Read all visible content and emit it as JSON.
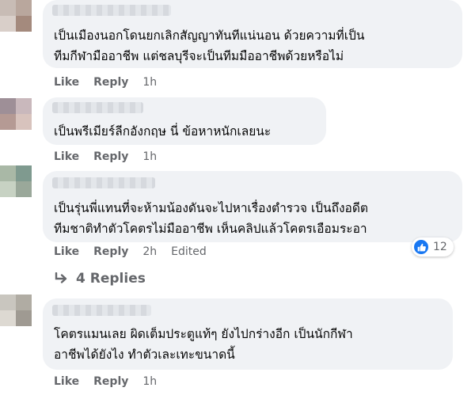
{
  "comments": [
    {
      "lines": [
        "เป็นเมืองนอกโดนยกเลิกสัญญาทันทีแน่นอน ด้วยความที่เป็น",
        "ทีมกีฬามืออาชีพ แต่ชลบุรีจะเป็นทีมมืออาชีพด้วยหรือไม่"
      ],
      "like": "Like",
      "reply": "Reply",
      "time": "1h",
      "avatar_colors": [
        "#c8bcb5",
        "#b9a79d",
        "#d9cfc9",
        "#a48a7d"
      ]
    },
    {
      "lines": [
        "เป็นพรีเมียร์ลีกอังกฤษ นี่ ข้อหาหนักเลยนะ"
      ],
      "like": "Like",
      "reply": "Reply",
      "time": "1h",
      "avatar_colors": [
        "#9e8f97",
        "#c9b8bc",
        "#b59a94",
        "#d8c3bd"
      ]
    },
    {
      "lines": [
        "เป็นรุ่นพี่แทนที่จะห้ามน้องดันจะไปหาเรื่องตำรวจ เป็นถึงอดีต",
        "ทีมชาติทำตัวโคตรไม่มืออาชีพ เห็นคลิปแล้วโคตรเอือมระอา"
      ],
      "like": "Like",
      "reply": "Reply",
      "time": "2h",
      "edited": "Edited",
      "reaction_count": "12",
      "replies_label": "4 Replies",
      "avatar_colors": [
        "#a9b8a6",
        "#7f9a8f",
        "#c7d2c3",
        "#9aa89a"
      ]
    },
    {
      "lines": [
        "โคตรแมนเลย ผิดเต็มประตูแท้ๆ ยังไปกร่างอีก เป็นนักกีฬา",
        "อาชีพได้ยังไง ทำตัวเละเทะขนาดนี้"
      ],
      "like": "Like",
      "reply": "Reply",
      "time": "1h",
      "avatar_colors": [
        "#c9c6bf",
        "#b0aca3",
        "#ddd9d2",
        "#9f9a92"
      ]
    }
  ],
  "theme": {
    "bubble": "#f0f2f5",
    "meta": "#65676b",
    "like_blue": "#1877f2"
  }
}
